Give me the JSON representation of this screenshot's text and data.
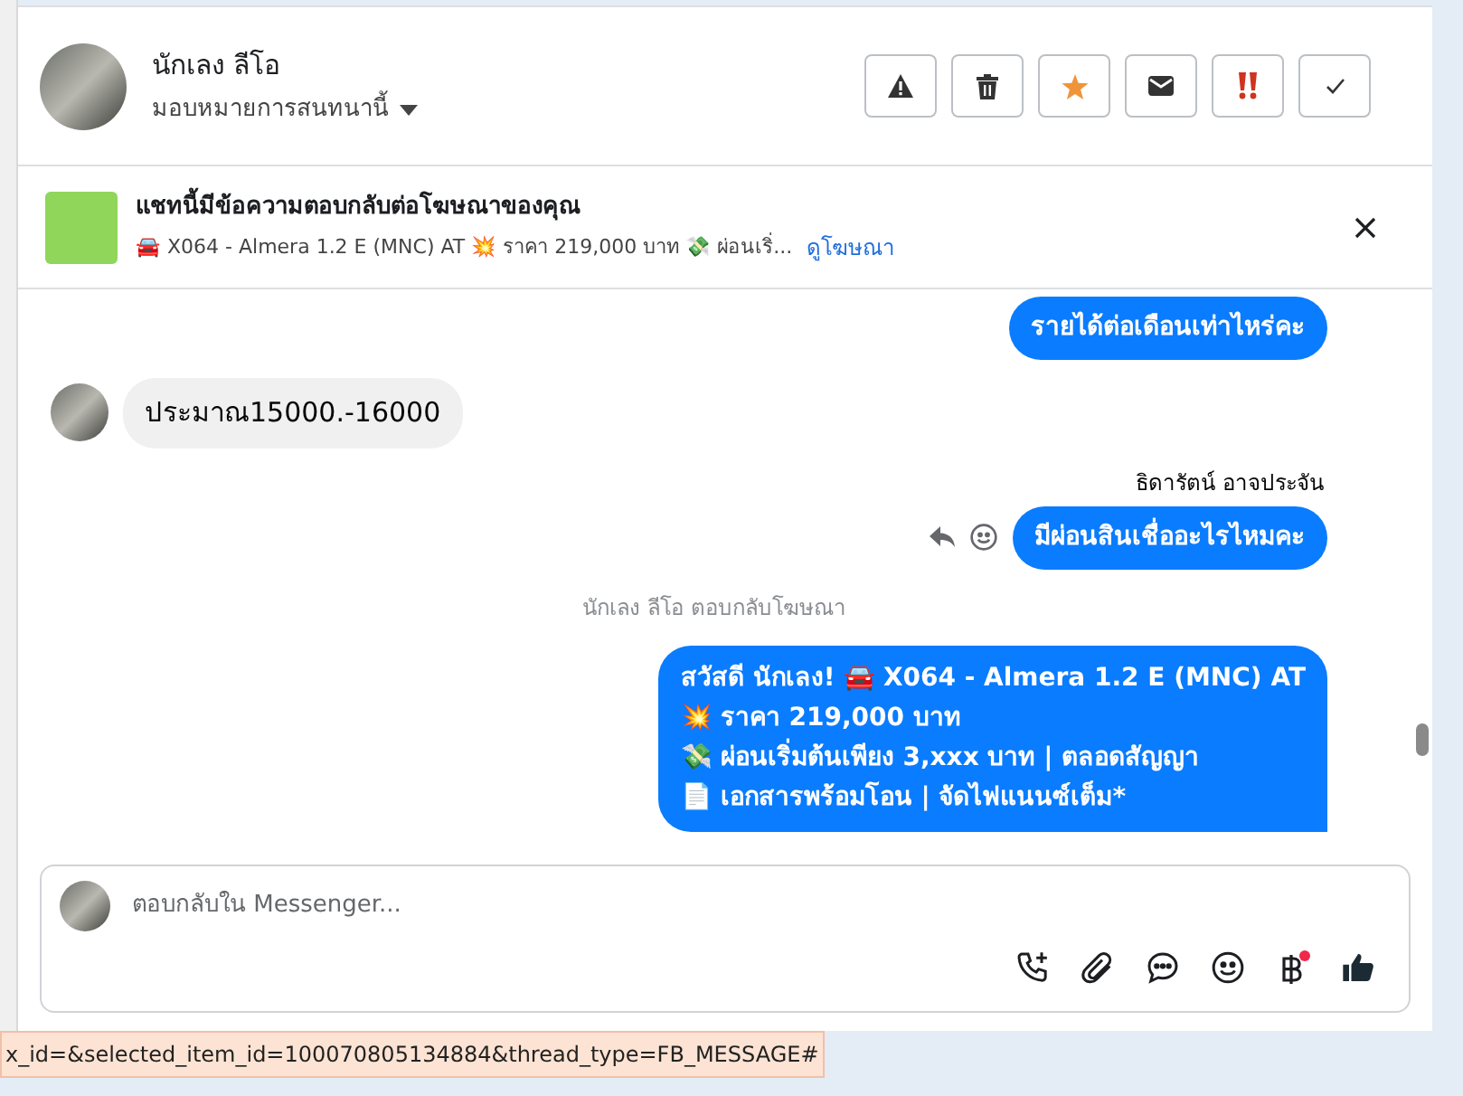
{
  "header": {
    "name": "นักเลง ลีโอ",
    "assign_label": "มอบหมายการสนทนานี้",
    "actions": [
      {
        "kind": "spam"
      },
      {
        "kind": "delete"
      },
      {
        "kind": "star"
      },
      {
        "kind": "mail"
      },
      {
        "kind": "urgent"
      },
      {
        "kind": "done"
      }
    ]
  },
  "ad_banner": {
    "title": "แชทนี้มีข้อความตอบกลับต่อโฆษณาของคุณ",
    "summary": "🚘 X064 - Almera 1.2 E (MNC) AT 💥 ราคา 219,000 บาท 💸 ผ่อนเริ่...",
    "link": "ดูโฆษณา"
  },
  "messages": [
    {
      "kind": "outgoing",
      "text": "รายได้ต่อเดือนเท่าไหร่คะ"
    },
    {
      "kind": "incoming",
      "text": "ประมาณ15000.-16000"
    },
    {
      "kind": "sender",
      "text": "ธิดารัตน์ อาจประจัน"
    },
    {
      "kind": "outgoing_actions",
      "text": "มีผ่อนสินเชื่ออะไรไหมคะ"
    },
    {
      "kind": "notice",
      "text": "นักเลง ลีโอ ตอบกลับโฆษณา"
    },
    {
      "kind": "outgoing_multi",
      "lines": [
        "สวัสดี นักเลง! 🚘 X064 - Almera 1.2 E (MNC) AT",
        "💥 ราคา 219,000 บาท",
        "💸 ผ่อนเริ่มต้นเพียง 3,xxx บาท | ตลอดสัญญา",
        "📄 เอกสารพร้อมโอน | จัดไฟแนนซ์เต็ม*"
      ]
    }
  ],
  "composer": {
    "placeholder": "ตอบกลับใน Messenger...",
    "tools": [
      {
        "kind": "call"
      },
      {
        "kind": "attach"
      },
      {
        "kind": "chat"
      },
      {
        "kind": "emoji"
      },
      {
        "kind": "baht",
        "badge": true
      },
      {
        "kind": "like"
      }
    ]
  },
  "status_bar": "x_id=&selected_item_id=100070805134884&thread_type=FB_MESSAGE#"
}
